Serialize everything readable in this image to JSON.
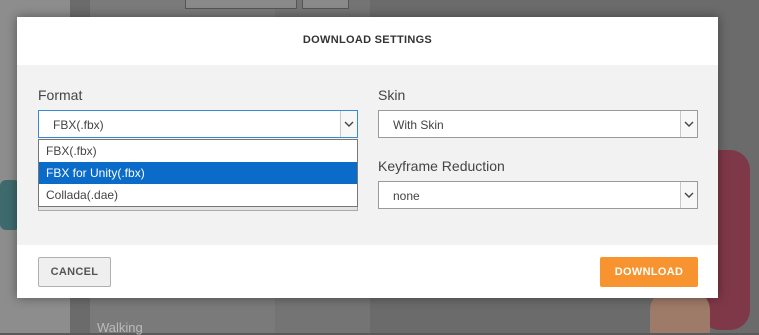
{
  "dialog": {
    "title": "DOWNLOAD SETTINGS",
    "format": {
      "label": "Format",
      "value": "FBX(.fbx)",
      "options": [
        "FBX(.fbx)",
        "FBX for Unity(.fbx)",
        "Collada(.dae)"
      ],
      "highlighted": "FBX for Unity(.fbx)"
    },
    "skin": {
      "label": "Skin",
      "value": "With Skin"
    },
    "keyframe": {
      "label": "Keyframe Reduction",
      "value": "none"
    },
    "cancel_label": "CANCEL",
    "download_label": "DOWNLOAD"
  },
  "background": {
    "walking_label": "Walking"
  },
  "colors": {
    "accent": "#f7942f",
    "selection": "#0a6bc9"
  }
}
